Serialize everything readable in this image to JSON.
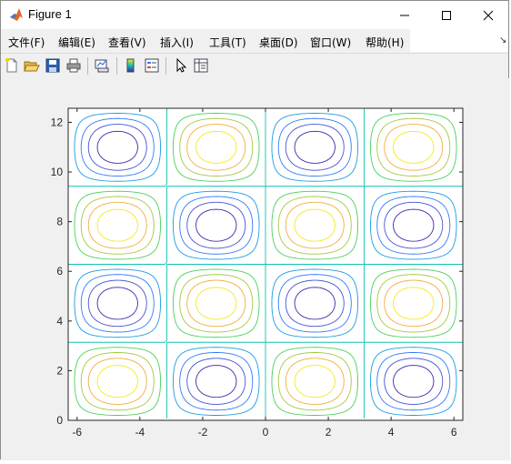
{
  "window": {
    "title": "Figure 1",
    "app_icon": "matlab-logo-icon",
    "controls": {
      "minimize": "minimize-icon",
      "maximize": "maximize-icon",
      "close": "close-icon"
    }
  },
  "menubar": {
    "items": [
      {
        "label": "文件(F)"
      },
      {
        "label": "编辑(E)"
      },
      {
        "label": "查看(V)"
      },
      {
        "label": "插入(I)"
      },
      {
        "label": "工具(T)"
      },
      {
        "label": "桌面(D)"
      },
      {
        "label": "窗口(W)"
      },
      {
        "label": "帮助(H)"
      }
    ],
    "dock_icon": "dock-arrow-icon"
  },
  "toolbar": {
    "buttons": [
      {
        "icon": "new-figure-icon"
      },
      {
        "icon": "open-file-icon"
      },
      {
        "icon": "save-icon"
      },
      {
        "icon": "print-icon"
      },
      {
        "icon": "link-plot-icon"
      },
      {
        "icon": "insert-colorbar-icon"
      },
      {
        "icon": "insert-legend-icon"
      },
      {
        "icon": "edit-plot-arrow-icon"
      },
      {
        "icon": "property-inspector-icon"
      }
    ]
  },
  "chart_data": {
    "type": "contour",
    "title": "",
    "xlabel": "",
    "ylabel": "",
    "function": "z = sin(x) * sin(y)",
    "xlim": [
      -6.283,
      6.283
    ],
    "ylim": [
      0,
      12.566
    ],
    "x_ticks": [
      "-6",
      "-4",
      "-2",
      "0",
      "2",
      "4",
      "6"
    ],
    "y_ticks": [
      "0",
      "2",
      "4",
      "6",
      "8",
      "10",
      "12"
    ],
    "levels": [
      -0.8,
      -0.6,
      -0.4,
      -0.2,
      0,
      0.2,
      0.4,
      0.6,
      0.8
    ],
    "colormap": [
      "#3e26a8",
      "#4352d4",
      "#2f79fb",
      "#1a9be2",
      "#10c2b3",
      "#46d15a",
      "#a5c640",
      "#f1ad3b",
      "#f6e81d"
    ],
    "grid": false,
    "axes_color": "#000000"
  }
}
